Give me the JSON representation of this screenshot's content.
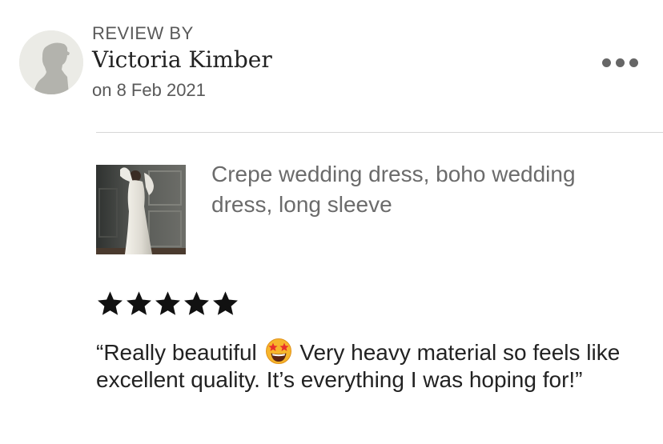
{
  "review": {
    "header_label": "REVIEW BY",
    "reviewer_name": "Victoria Kimber",
    "date": "on 8 Feb 2021",
    "more_icon": "more-horizontal-icon",
    "avatar_icon": "default-user-silhouette"
  },
  "product": {
    "title": "Crepe wedding dress, boho wedding dress, long sleeve"
  },
  "rating": {
    "stars": 5,
    "max": 5,
    "star_color": "#111111"
  },
  "review_body": {
    "text_before_emoji": "“Really beautiful ",
    "emoji": "star-struck-emoji",
    "text_after_emoji": " Very heavy material so feels like excellent quality. It’s everything I was hoping for!”"
  },
  "colors": {
    "text_primary": "#222222",
    "text_secondary": "#595959",
    "product_title": "#6b6b6b",
    "divider": "#d6d6d6",
    "avatar_bg": "#ebebe6"
  }
}
